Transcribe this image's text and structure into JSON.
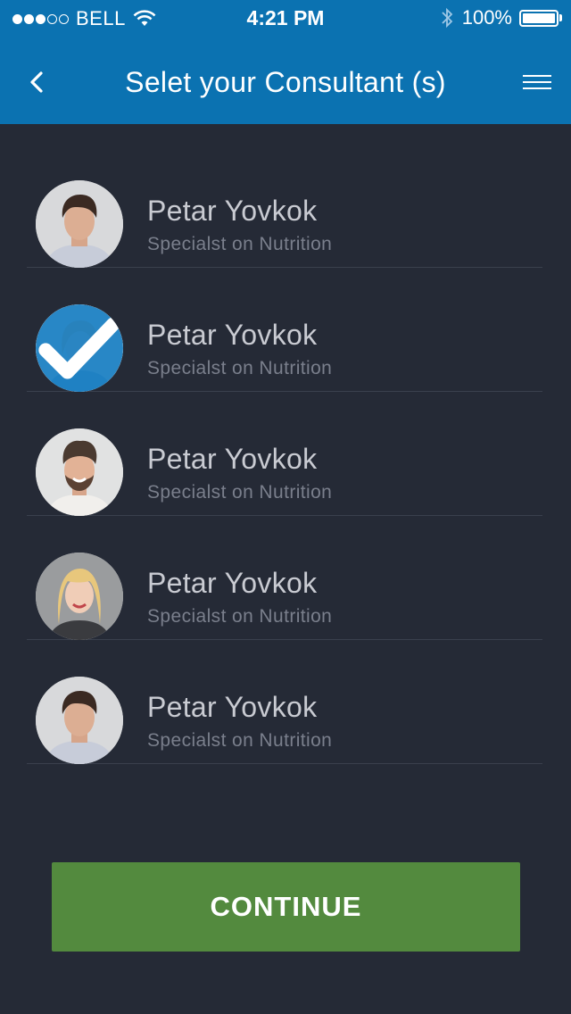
{
  "status_bar": {
    "signal_filled": 3,
    "signal_total": 5,
    "carrier": "BELL",
    "time": "4:21 PM",
    "battery_percent": "100%"
  },
  "nav": {
    "title": "Selet your Consultant (s)",
    "back_icon": "chevron-left-icon",
    "menu_icon": "hamburger-menu-icon"
  },
  "consultants": [
    {
      "name": "Petar Yovkok",
      "role": "Specialst on Nutrition",
      "selected": false
    },
    {
      "name": "Petar Yovkok",
      "role": "Specialst on Nutrition",
      "selected": true
    },
    {
      "name": "Petar Yovkok",
      "role": "Specialst on Nutrition",
      "selected": false
    },
    {
      "name": "Petar Yovkok",
      "role": "Specialst on Nutrition",
      "selected": false
    },
    {
      "name": "Petar Yovkok",
      "role": "Specialst on Nutrition",
      "selected": false
    }
  ],
  "continue_label": "CONTINUE",
  "colors": {
    "header": "#0b72b1",
    "background": "#252a36",
    "continue": "#538a3e",
    "selected": "#1a80c4"
  }
}
